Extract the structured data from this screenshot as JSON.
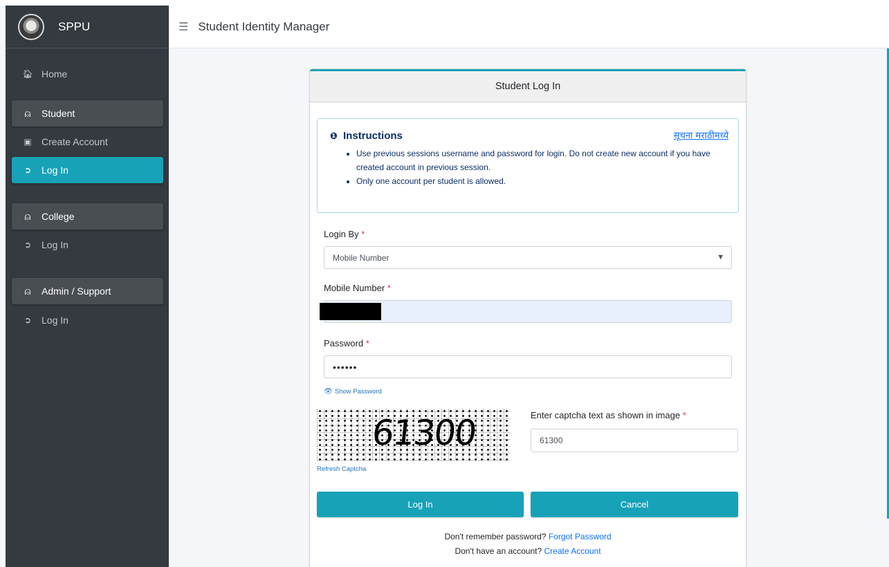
{
  "brand": {
    "name": "SPPU"
  },
  "navbar": {
    "title": "Student Identity Manager"
  },
  "sidebar": {
    "home": "Home",
    "student_header": "Student",
    "student_create": "Create Account",
    "student_login": "Log In",
    "college_header": "College",
    "college_login": "Log In",
    "admin_header": "Admin / Support",
    "admin_login": "Log In"
  },
  "card": {
    "header": "Student Log In",
    "instructions": {
      "title": "Instructions",
      "marathi_link": "सूचना मराठीमध्ये",
      "items": [
        "Use previous sessions username and password for login. Do not create new account if you have created account in previous session.",
        "Only one account per student is allowed."
      ]
    },
    "login_by": {
      "label": "Login By",
      "value": "Mobile Number"
    },
    "mobile": {
      "label": "Mobile Number"
    },
    "password": {
      "label": "Password",
      "value": "••••••",
      "show_label": "Show Password"
    },
    "captcha": {
      "image_text": "61300",
      "refresh_label": "Refresh Captcha",
      "label": "Enter captcha text as shown in image",
      "value": "61300"
    },
    "buttons": {
      "login": "Log In",
      "cancel": "Cancel"
    },
    "footer": {
      "forgot_prompt": "Don't remember password?",
      "forgot_link": "Forgot Password",
      "create_prompt": "Don't have an account?",
      "create_link": "Create Account"
    }
  },
  "colors": {
    "accent": "#17a2b8",
    "sidebar": "#343a40",
    "link": "#0d6efd"
  }
}
